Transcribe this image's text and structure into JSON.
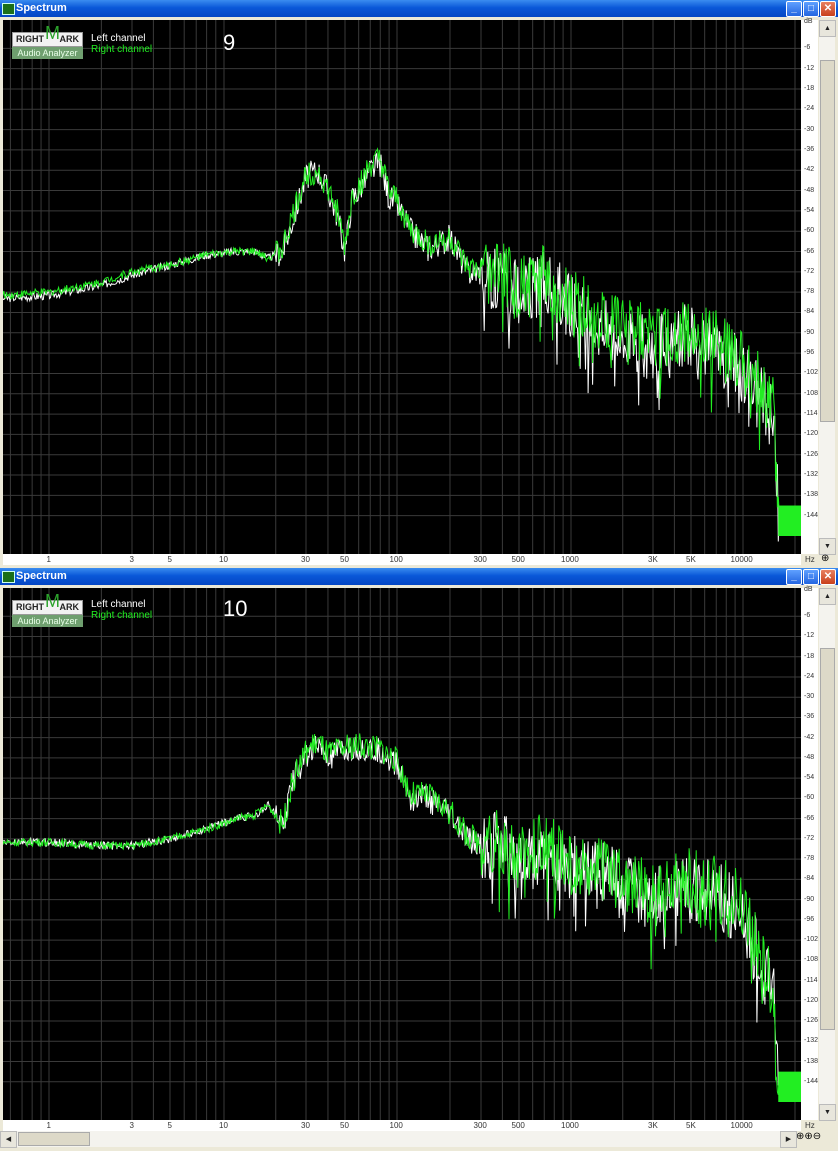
{
  "colors": {
    "left_channel": "#ffffff",
    "right_channel": "#22ee22",
    "background": "#000000",
    "grid": "#3a3a3a"
  },
  "logo": {
    "line1_left": "RIGHT",
    "line1_mark": "M",
    "line1_right": "ARK",
    "line2": "Audio Analyzer"
  },
  "windows": [
    {
      "title": "Spectrum",
      "number": "9",
      "legend": {
        "left": "Left channel",
        "right": "Right channel"
      },
      "y_ticks": [
        "dB",
        "-6",
        "-12",
        "-18",
        "-24",
        "-30",
        "-36",
        "-42",
        "-48",
        "-54",
        "-60",
        "-66",
        "-72",
        "-78",
        "-84",
        "-90",
        "-96",
        "-102",
        "-108",
        "-114",
        "-120",
        "-126",
        "-132",
        "-138",
        "-144"
      ],
      "x_ticks": [
        "1",
        "3",
        "5",
        "10",
        "30",
        "50",
        "100",
        "300",
        "500",
        "1000",
        "3K",
        "5K",
        "10000",
        "Hz"
      ]
    },
    {
      "title": "Spectrum",
      "number": "10",
      "legend": {
        "left": "Left channel",
        "right": "Right channel"
      },
      "y_ticks": [
        "dB",
        "-6",
        "-12",
        "-18",
        "-24",
        "-30",
        "-36",
        "-42",
        "-48",
        "-54",
        "-60",
        "-66",
        "-72",
        "-78",
        "-84",
        "-90",
        "-96",
        "-102",
        "-108",
        "-114",
        "-120",
        "-126",
        "-132",
        "-138",
        "-144"
      ],
      "x_ticks": [
        "1",
        "3",
        "5",
        "10",
        "30",
        "50",
        "100",
        "300",
        "500",
        "1000",
        "3K",
        "5K",
        "10000",
        "Hz"
      ]
    }
  ],
  "chart_data": [
    {
      "type": "line",
      "x_scale": "log",
      "xlim": [
        0.5,
        22050
      ],
      "ylim": [
        -150,
        0
      ],
      "xlabel": "Hz",
      "ylabel": "dB",
      "series": [
        {
          "name": "Left channel",
          "x": [
            0.5,
            1,
            2,
            3,
            5,
            8,
            12,
            15,
            18,
            22,
            25,
            30,
            35,
            40,
            45,
            50,
            55,
            60,
            70,
            80,
            90,
            100,
            120,
            150,
            200,
            250,
            300,
            400,
            500,
            700,
            1000,
            1500,
            2000,
            3000,
            4000,
            5000,
            7000,
            9000,
            11000,
            13000,
            15000,
            16000,
            17000,
            18000,
            20000,
            22050
          ],
          "y": [
            -80,
            -79,
            -76,
            -73,
            -70,
            -67,
            -66,
            -66,
            -68,
            -66,
            -57,
            -44,
            -42,
            -48,
            -55,
            -66,
            -50,
            -48,
            -42,
            -40,
            -50,
            -52,
            -60,
            -65,
            -62,
            -72,
            -72,
            -74,
            -78,
            -75,
            -82,
            -88,
            -92,
            -95,
            -93,
            -90,
            -95,
            -100,
            -102,
            -110,
            -115,
            -144,
            -146,
            -147,
            -147,
            -147
          ]
        },
        {
          "name": "Right channel",
          "x": [
            0.5,
            1,
            2,
            3,
            5,
            8,
            12,
            15,
            18,
            22,
            25,
            30,
            35,
            40,
            45,
            50,
            55,
            60,
            70,
            80,
            90,
            100,
            120,
            150,
            200,
            250,
            300,
            400,
            500,
            700,
            1000,
            1500,
            2000,
            3000,
            4000,
            5000,
            7000,
            9000,
            11000,
            13000,
            15000,
            16000,
            17000,
            18000,
            20000,
            22050
          ],
          "y": [
            -79,
            -78,
            -75,
            -72,
            -70,
            -67,
            -66,
            -66,
            -68,
            -65,
            -56,
            -43,
            -42,
            -48,
            -54,
            -65,
            -50,
            -47,
            -41,
            -39,
            -49,
            -51,
            -60,
            -64,
            -62,
            -71,
            -72,
            -73,
            -77,
            -74,
            -81,
            -86,
            -88,
            -92,
            -91,
            -88,
            -93,
            -98,
            -100,
            -108,
            -113,
            -143,
            -145,
            -146,
            -146,
            -146
          ]
        }
      ]
    },
    {
      "type": "line",
      "x_scale": "log",
      "xlim": [
        0.5,
        22050
      ],
      "ylim": [
        -150,
        0
      ],
      "xlabel": "Hz",
      "ylabel": "dB",
      "series": [
        {
          "name": "Left channel",
          "x": [
            0.5,
            1,
            2,
            3,
            5,
            8,
            12,
            15,
            18,
            22,
            25,
            30,
            35,
            40,
            50,
            60,
            70,
            80,
            100,
            120,
            150,
            200,
            250,
            300,
            400,
            500,
            700,
            1000,
            1500,
            2000,
            3000,
            4000,
            5000,
            7000,
            9000,
            11000,
            13000,
            15000,
            16000,
            17000,
            18000,
            20000,
            22050
          ],
          "y": [
            -73,
            -73,
            -74,
            -74,
            -72,
            -69,
            -66,
            -65,
            -62,
            -68,
            -55,
            -47,
            -44,
            -48,
            -46,
            -45,
            -46,
            -46,
            -50,
            -60,
            -60,
            -65,
            -72,
            -74,
            -74,
            -78,
            -75,
            -80,
            -82,
            -85,
            -90,
            -88,
            -86,
            -88,
            -93,
            -100,
            -110,
            -118,
            -144,
            -146,
            -147,
            -147,
            -147
          ]
        },
        {
          "name": "Right channel",
          "x": [
            0.5,
            1,
            2,
            3,
            5,
            8,
            12,
            15,
            18,
            22,
            25,
            30,
            35,
            40,
            50,
            60,
            70,
            80,
            100,
            120,
            150,
            200,
            250,
            300,
            400,
            500,
            700,
            1000,
            1500,
            2000,
            3000,
            4000,
            5000,
            7000,
            9000,
            11000,
            13000,
            15000,
            16000,
            17000,
            18000,
            20000,
            22050
          ],
          "y": [
            -73,
            -73,
            -74,
            -74,
            -72,
            -69,
            -66,
            -65,
            -62,
            -68,
            -55,
            -46,
            -43,
            -47,
            -45,
            -44,
            -45,
            -45,
            -49,
            -59,
            -59,
            -64,
            -71,
            -73,
            -73,
            -77,
            -74,
            -79,
            -81,
            -84,
            -88,
            -86,
            -84,
            -86,
            -90,
            -98,
            -108,
            -116,
            -143,
            -145,
            -146,
            -146,
            -146
          ]
        }
      ]
    }
  ]
}
